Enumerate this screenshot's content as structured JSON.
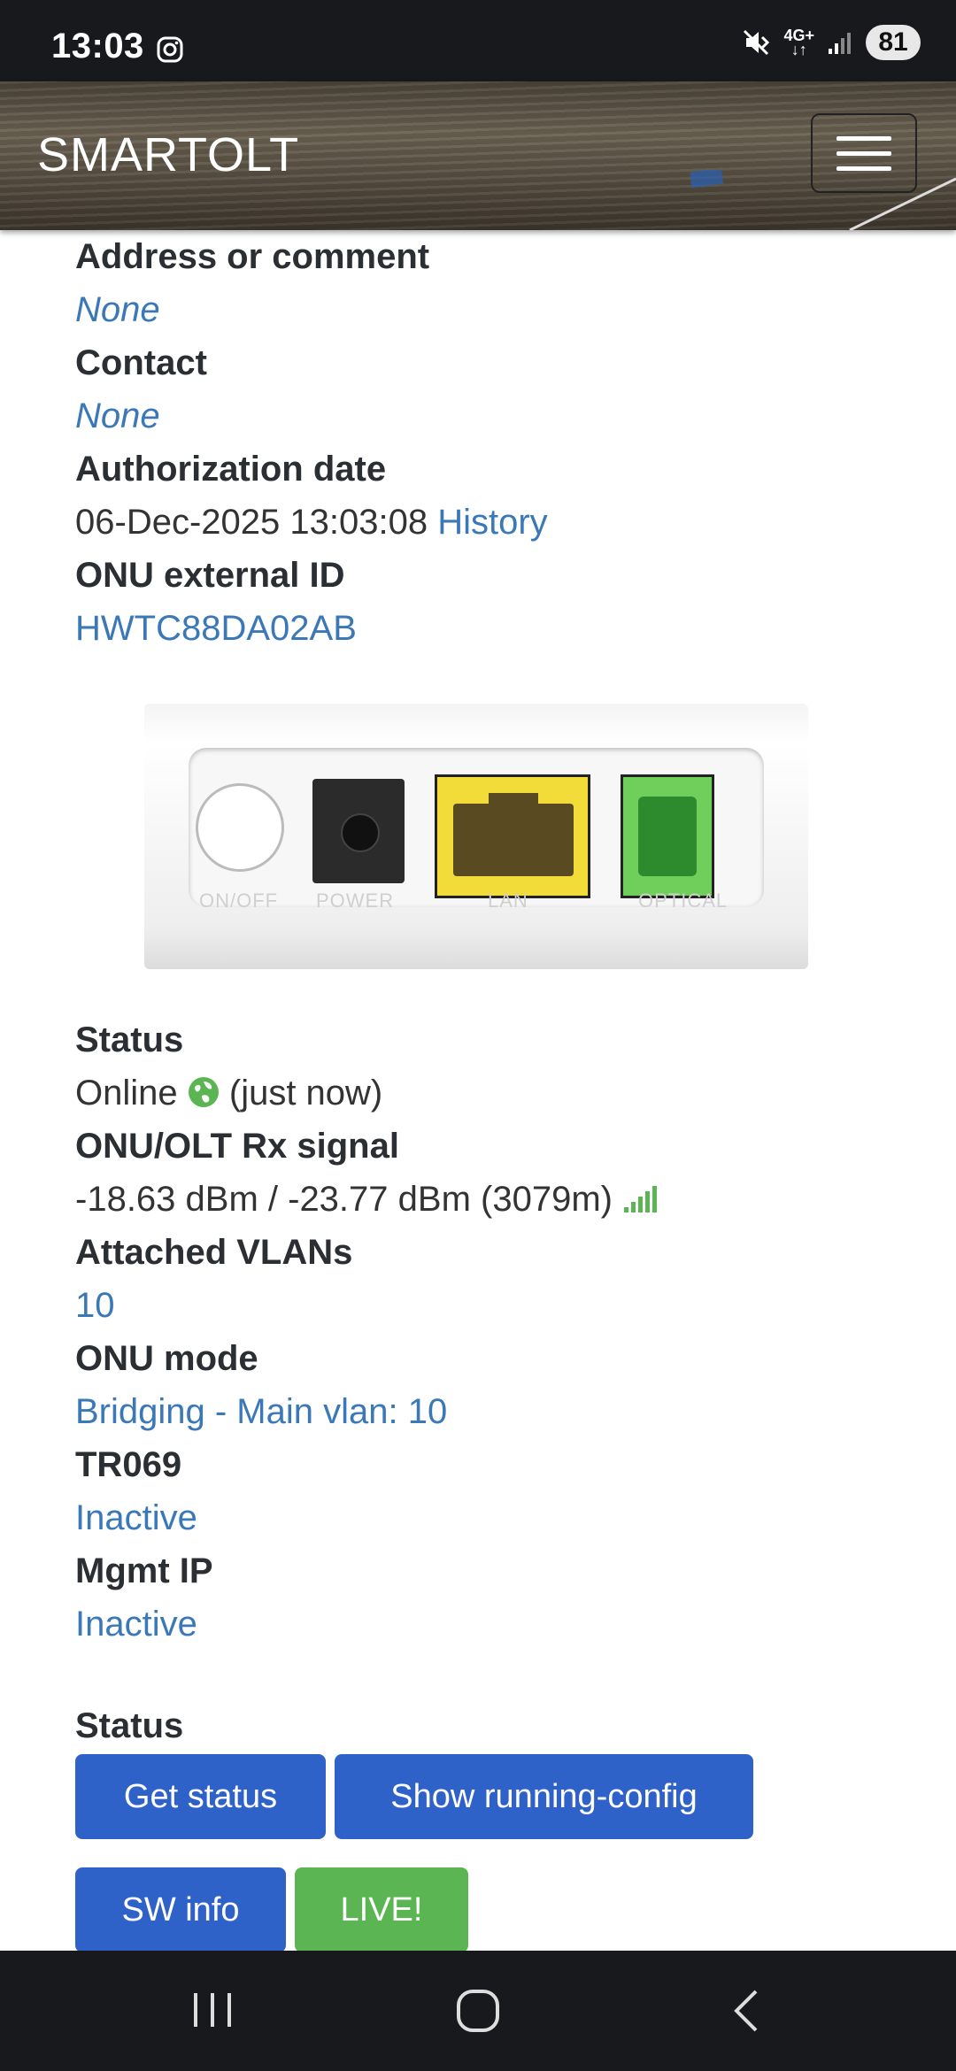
{
  "status_bar": {
    "time": "13:03",
    "network": "4G+",
    "battery": "81",
    "icons": [
      "instagram-icon",
      "mute-icon",
      "signal-icon"
    ]
  },
  "header": {
    "brand": "SMARTOLT",
    "menu_icon": "hamburger-icon"
  },
  "details": {
    "address_label": "Address or comment",
    "address_value": "None",
    "contact_label": "Contact",
    "contact_value": "None",
    "auth_label": "Authorization date",
    "auth_value": "06-Dec-2025 13:03:08",
    "auth_history": "History",
    "ext_id_label": "ONU external ID",
    "ext_id_value": "HWTC88DA02AB"
  },
  "device": {
    "ports": [
      "ON/OFF",
      "POWER",
      "LAN",
      "OPTICAL"
    ]
  },
  "state": {
    "status_label": "Status",
    "status_value": "Online",
    "status_time": "(just now)",
    "rx_label": "ONU/OLT Rx signal",
    "rx_value": "-18.63 dBm / -23.77 dBm (3079m)",
    "vlans_label": "Attached VLANs",
    "vlans_value": "10",
    "mode_label": "ONU mode",
    "mode_value": "Bridging - Main vlan: 10",
    "tr069_label": "TR069",
    "tr069_value": "Inactive",
    "mgmt_label": "Mgmt IP",
    "mgmt_value": "Inactive"
  },
  "actions": {
    "section_label": "Status",
    "get_status": "Get status",
    "show_config": "Show running-config",
    "sw_info": "SW info",
    "live": "LIVE!"
  },
  "colors": {
    "link": "#3a78b8",
    "primary": "#2f62c9",
    "success": "#5cb553"
  }
}
